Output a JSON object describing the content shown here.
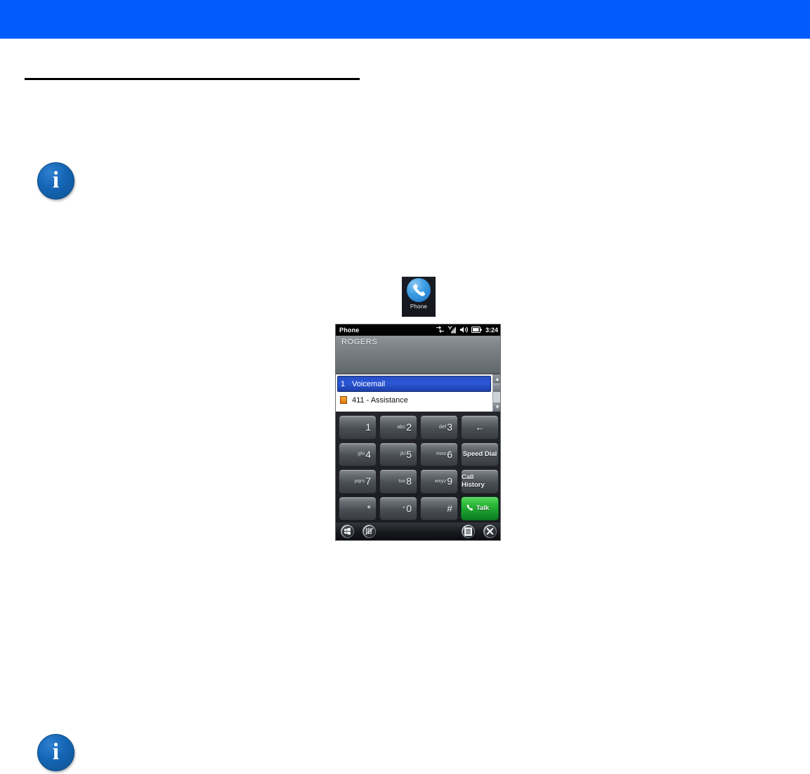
{
  "page": {
    "header_accent_color": "#005cfc",
    "rule_color": "#000000"
  },
  "notes": [
    {
      "icon": "info-icon",
      "text": ""
    },
    {
      "icon": "info-icon",
      "text": ""
    }
  ],
  "launcher": {
    "icon": "phone-icon",
    "label": "Phone"
  },
  "device": {
    "titlebar": {
      "app_name": "Phone",
      "clock": "3:24",
      "icons": [
        "connectivity-icon",
        "signal-icon",
        "volume-icon",
        "battery-icon"
      ]
    },
    "carrier": {
      "name": "ROGERS"
    },
    "call_list": {
      "rows": [
        {
          "index": "1",
          "label": "Voicemail",
          "selected": true,
          "icon": ""
        },
        {
          "index": "",
          "label": "411 - Assistance",
          "selected": false,
          "icon": "sim-contact-icon"
        }
      ],
      "scrollbar": {
        "up": "▲",
        "down": "▼"
      }
    },
    "keypad": {
      "keys": [
        {
          "type": "digit",
          "letters": "",
          "digit": "1",
          "name": "key-1"
        },
        {
          "type": "digit",
          "letters": "abc",
          "digit": "2",
          "name": "key-2"
        },
        {
          "type": "digit",
          "letters": "def",
          "digit": "3",
          "name": "key-3"
        },
        {
          "type": "func",
          "label": "←",
          "name": "key-backspace"
        },
        {
          "type": "digit",
          "letters": "ghi",
          "digit": "4",
          "name": "key-4"
        },
        {
          "type": "digit",
          "letters": "jkl",
          "digit": "5",
          "name": "key-5"
        },
        {
          "type": "digit",
          "letters": "mno",
          "digit": "6",
          "name": "key-6"
        },
        {
          "type": "func",
          "label": "Speed Dial",
          "name": "key-speed-dial"
        },
        {
          "type": "digit",
          "letters": "pqrs",
          "digit": "7",
          "name": "key-7"
        },
        {
          "type": "digit",
          "letters": "tuv",
          "digit": "8",
          "name": "key-8"
        },
        {
          "type": "digit",
          "letters": "wxyz",
          "digit": "9",
          "name": "key-9"
        },
        {
          "type": "func",
          "label": "Call History",
          "name": "key-call-history"
        },
        {
          "type": "digit",
          "letters": "",
          "digit": "*",
          "name": "key-star"
        },
        {
          "type": "digit",
          "letters": "+",
          "digit": "0",
          "name": "key-0"
        },
        {
          "type": "digit",
          "letters": "",
          "digit": "#",
          "name": "key-hash"
        },
        {
          "type": "talk",
          "label": "Talk",
          "name": "key-talk"
        }
      ],
      "talk_color": "#17962a"
    },
    "taskbar": {
      "buttons": [
        {
          "name": "start-button",
          "icon": "windows-start-icon"
        },
        {
          "name": "input-panel-button",
          "icon": "keyboard-icon"
        },
        {
          "name": "menu-button",
          "icon": "menu-icon"
        },
        {
          "name": "close-button",
          "icon": "close-icon"
        }
      ]
    }
  }
}
